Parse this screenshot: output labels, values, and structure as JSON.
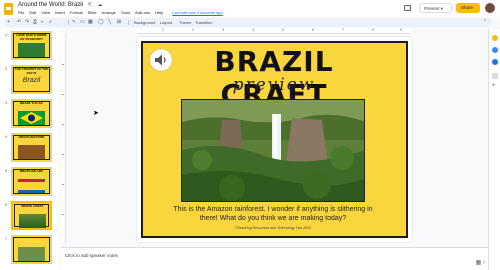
{
  "app": {
    "doc_title": "Around the World: Brazil",
    "menu": [
      "File",
      "Edit",
      "View",
      "Insert",
      "Format",
      "Slide",
      "Arrange",
      "Tools",
      "Add-ons",
      "Help"
    ],
    "last_edit": "Last edit was 4 seconds ago",
    "present_label": "Present",
    "share_label": "Share",
    "accent_color": "#fbbc04"
  },
  "toolbar": {
    "background_label": "Background",
    "layout_label": "Layout",
    "theme_label": "Theme",
    "transition_label": "Transition"
  },
  "filmstrip": {
    "slides": [
      {
        "num": "1",
        "title": "LOOK WHO'S INSIDE MY PASSPORT!"
      },
      {
        "num": "2",
        "title": "THE COUNTRY OF THE DAY IS"
      },
      {
        "num": "3",
        "title": "BRAZIL'S FLAG"
      },
      {
        "num": "4",
        "title": "BRAZILIAN FOOD"
      },
      {
        "num": "5",
        "title": "BRAZILIAN ABC"
      },
      {
        "num": "6",
        "title": "BRAZIL CRAFT"
      },
      {
        "num": "7",
        "title": ""
      }
    ],
    "active_index": 5
  },
  "ruler": {
    "h_marks": [
      "1",
      "2",
      "3",
      "4",
      "5",
      "6",
      "7",
      "8",
      "9"
    ]
  },
  "slide": {
    "title": "BRAZIL CRAFT",
    "subtitle": "preview",
    "body": "This is the Amazon rainforest. I wonder if anything is slithering in there! What do you think we are making today?",
    "credit": "©Teaching Resources and Technology Tips 2015",
    "background_color": "#f9d63d"
  },
  "notes": {
    "placeholder": "Click to add speaker notes"
  }
}
